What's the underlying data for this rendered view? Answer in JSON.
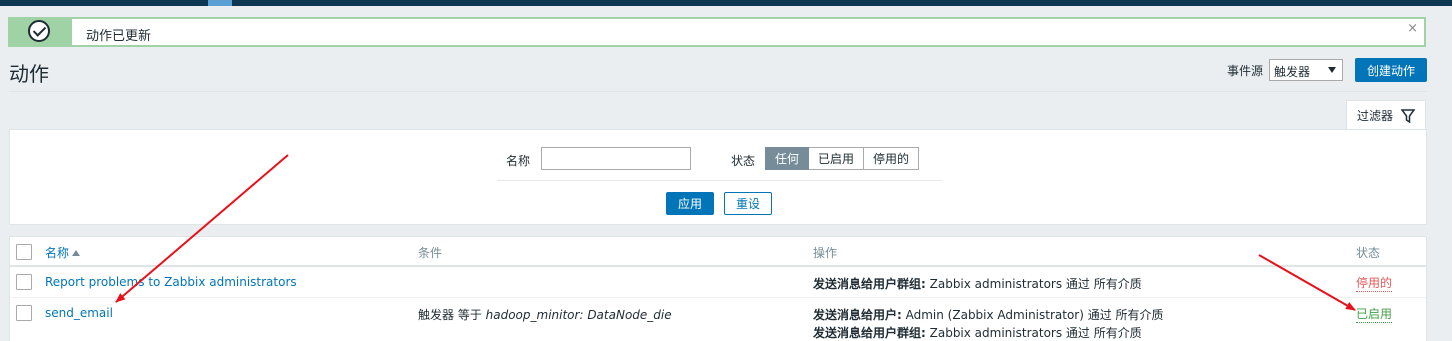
{
  "message": {
    "text": "动作已更新",
    "close_glyph": "×"
  },
  "page": {
    "title": "动作"
  },
  "header": {
    "event_source_label": "事件源",
    "event_source_value": "触发器",
    "create_button": "创建动作"
  },
  "filter": {
    "tab_label": "过滤器",
    "name_label": "名称",
    "name_value": "",
    "status_label": "状态",
    "status_options": [
      "任何",
      "已启用",
      "停用的"
    ],
    "status_selected": "任何",
    "apply_button": "应用",
    "reset_button": "重设"
  },
  "table": {
    "headers": {
      "name": "名称",
      "conditions": "条件",
      "operations": "操作",
      "status": "状态"
    },
    "rows": [
      {
        "name": "Report problems to Zabbix administrators",
        "condition_prefix": "",
        "condition_value": "",
        "operations": [
          {
            "label": "发送消息给用户群组:",
            "text": " Zabbix administrators 通过 所有介质"
          }
        ],
        "status": "停用的"
      },
      {
        "name": "send_email",
        "condition_prefix": "触发器 等于 ",
        "condition_value": "hadoop_minitor: DataNode_die",
        "operations": [
          {
            "label": "发送消息给用户:",
            "text": " Admin (Zabbix Administrator) 通过 所有介质"
          },
          {
            "label": "发送消息给用户群组:",
            "text": " Zabbix administrators 通过 所有介质"
          }
        ],
        "status": "已启用"
      }
    ]
  },
  "colors": {
    "accent": "#0275b8",
    "success": "#9fd2a5",
    "disabled": "#e45959",
    "enabled": "#429e47",
    "annotation": "#e8111b"
  }
}
